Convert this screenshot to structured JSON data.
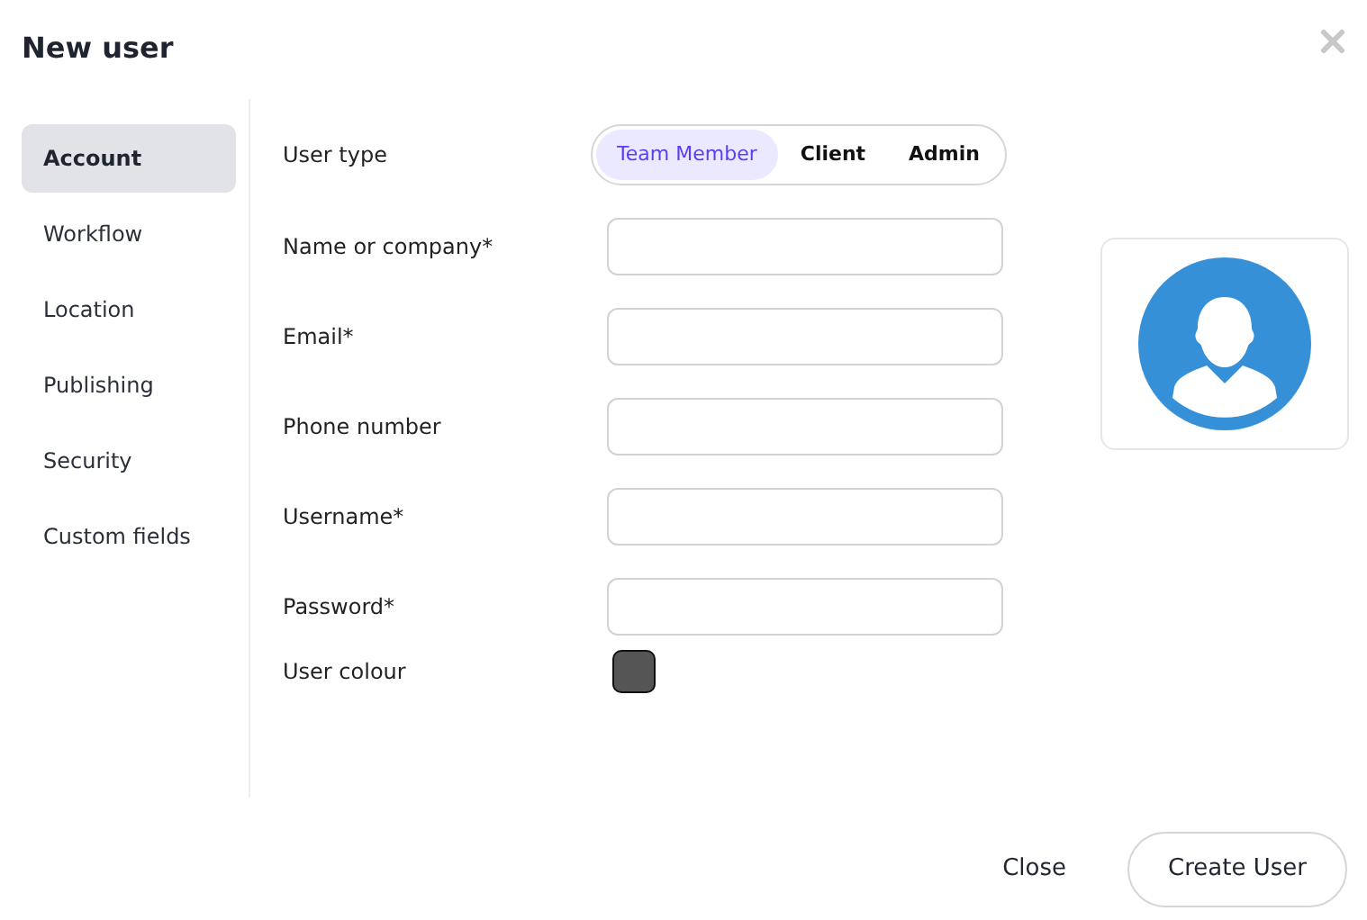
{
  "dialog": {
    "title": "New user"
  },
  "sidebar": {
    "items": [
      {
        "label": "Account",
        "selected": true
      },
      {
        "label": "Workflow",
        "selected": false
      },
      {
        "label": "Location",
        "selected": false
      },
      {
        "label": "Publishing",
        "selected": false
      },
      {
        "label": "Security",
        "selected": false
      },
      {
        "label": "Custom fields",
        "selected": false
      }
    ]
  },
  "user_type": {
    "label": "User type",
    "options": [
      {
        "label": "Team Member",
        "selected": true
      },
      {
        "label": "Client",
        "selected": false
      },
      {
        "label": "Admin",
        "selected": false
      }
    ]
  },
  "fields": [
    {
      "label": "Name or company*"
    },
    {
      "label": "Email*"
    },
    {
      "label": "Phone number"
    },
    {
      "label": "Username*"
    },
    {
      "label": "Password*"
    }
  ],
  "user_colour": {
    "label": "User colour",
    "color": "#555555"
  },
  "buttons": [
    {
      "kind": "plain",
      "label": "Close"
    },
    {
      "kind": "outlined",
      "label": "Create User"
    }
  ]
}
